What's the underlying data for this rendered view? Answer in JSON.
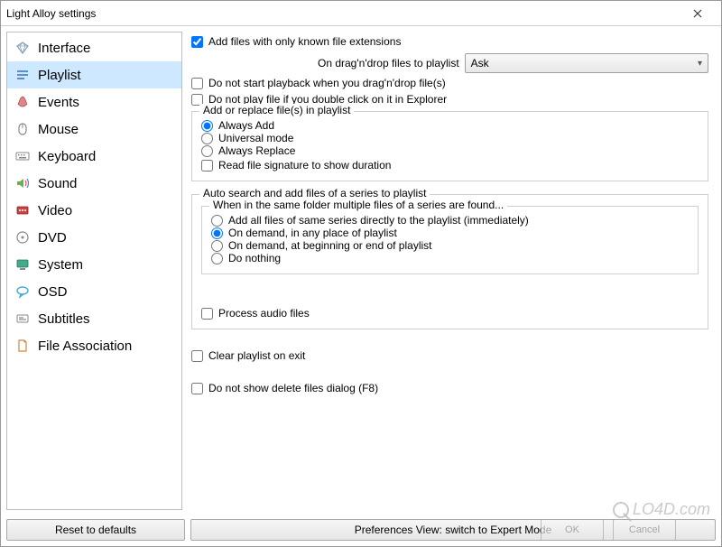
{
  "window": {
    "title": "Light Alloy settings"
  },
  "sidebar": {
    "items": [
      {
        "label": "Interface",
        "icon": "diamond"
      },
      {
        "label": "Playlist",
        "icon": "playlist",
        "selected": true
      },
      {
        "label": "Events",
        "icon": "events"
      },
      {
        "label": "Mouse",
        "icon": "mouse"
      },
      {
        "label": "Keyboard",
        "icon": "keyboard"
      },
      {
        "label": "Sound",
        "icon": "sound"
      },
      {
        "label": "Video",
        "icon": "video"
      },
      {
        "label": "DVD",
        "icon": "dvd"
      },
      {
        "label": "System",
        "icon": "system"
      },
      {
        "label": "OSD",
        "icon": "osd"
      },
      {
        "label": "Subtitles",
        "icon": "subtitles"
      },
      {
        "label": "File Association",
        "icon": "fileassoc"
      }
    ]
  },
  "content": {
    "add_known_ext": {
      "label": "Add files with only known file extensions",
      "checked": true
    },
    "dragdrop_label": "On drag'n'drop files to playlist",
    "dragdrop_select": {
      "value": "Ask"
    },
    "no_start_playback": {
      "label": "Do not start playback when you drag'n'drop file(s)",
      "checked": false
    },
    "no_play_dblclick": {
      "label": "Do not play file if you double click on it in Explorer",
      "checked": false
    },
    "group_addreplace": {
      "title": "Add or replace file(s) in playlist",
      "options": [
        {
          "label": "Always Add",
          "checked": true
        },
        {
          "label": "Universal mode",
          "checked": false
        },
        {
          "label": "Always Replace",
          "checked": false
        }
      ],
      "read_signature": {
        "label": "Read file signature to show duration",
        "checked": false
      }
    },
    "group_autosearch": {
      "title": "Auto search and add files of a series to playlist",
      "sub_title": "When in the same folder multiple files of a series are found...",
      "options": [
        {
          "label": "Add all files of same series directly to the playlist (immediately)",
          "checked": false
        },
        {
          "label": "On demand, in any place of playlist",
          "checked": true
        },
        {
          "label": "On demand, at beginning or end of playlist",
          "checked": false
        },
        {
          "label": "Do nothing",
          "checked": false
        }
      ],
      "process_audio": {
        "label": "Process audio files",
        "checked": false
      }
    },
    "clear_on_exit": {
      "label": "Clear playlist on exit",
      "checked": false
    },
    "no_delete_dialog": {
      "label": "Do not show delete files dialog (F8)",
      "checked": false
    }
  },
  "footer": {
    "reset": "Reset to defaults",
    "mode": "Preferences View: switch to Expert Mode",
    "ok": "OK",
    "cancel": "Cancel"
  },
  "watermark": "LO4D.com"
}
